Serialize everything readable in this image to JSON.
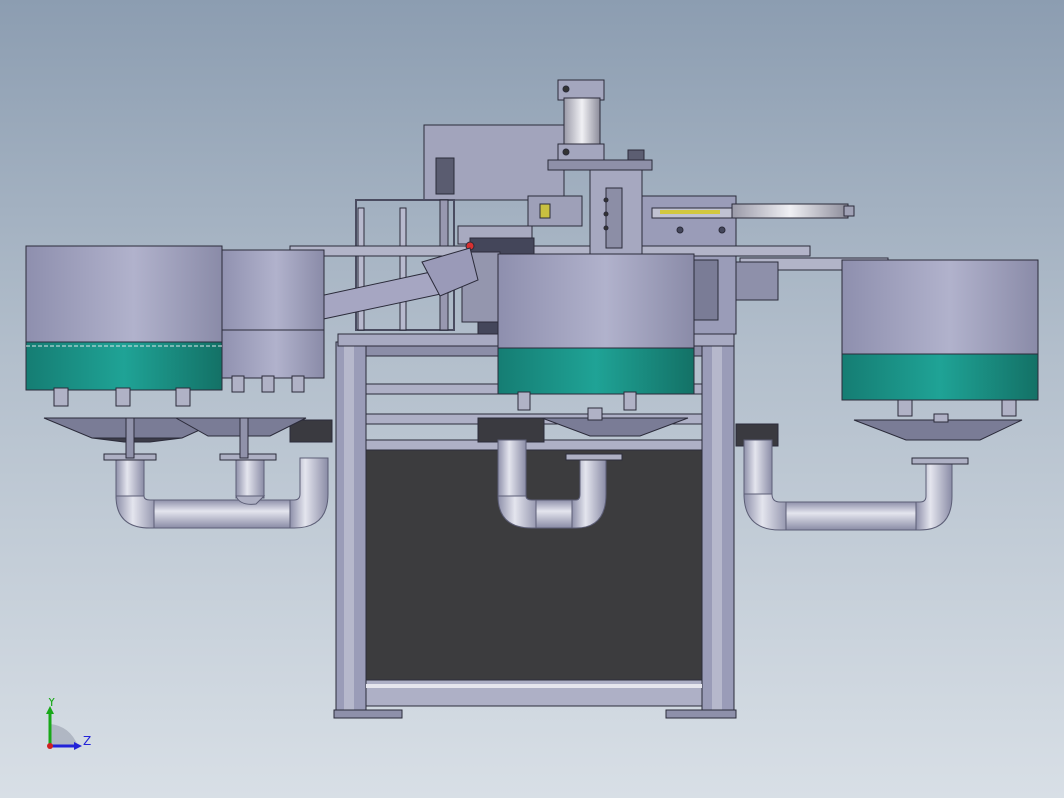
{
  "viewport": {
    "background_top": "#8c9db1",
    "background_bottom": "#d8dfe6"
  },
  "model": {
    "colors": {
      "frame": "#9a9cb8",
      "frame_dark": "#6e7090",
      "bowl": "#a3a4c2",
      "bowl_band": "#1b9488",
      "panel": "#3c3c3e",
      "pipe": "#b4b6cc",
      "highlight": "#e8e8f0",
      "edge": "#2b2b3a"
    }
  },
  "triad": {
    "y_label": "Y",
    "z_label": "Z",
    "y_color": "#18a818",
    "z_color": "#2222d8",
    "origin_color": "#d02020"
  }
}
